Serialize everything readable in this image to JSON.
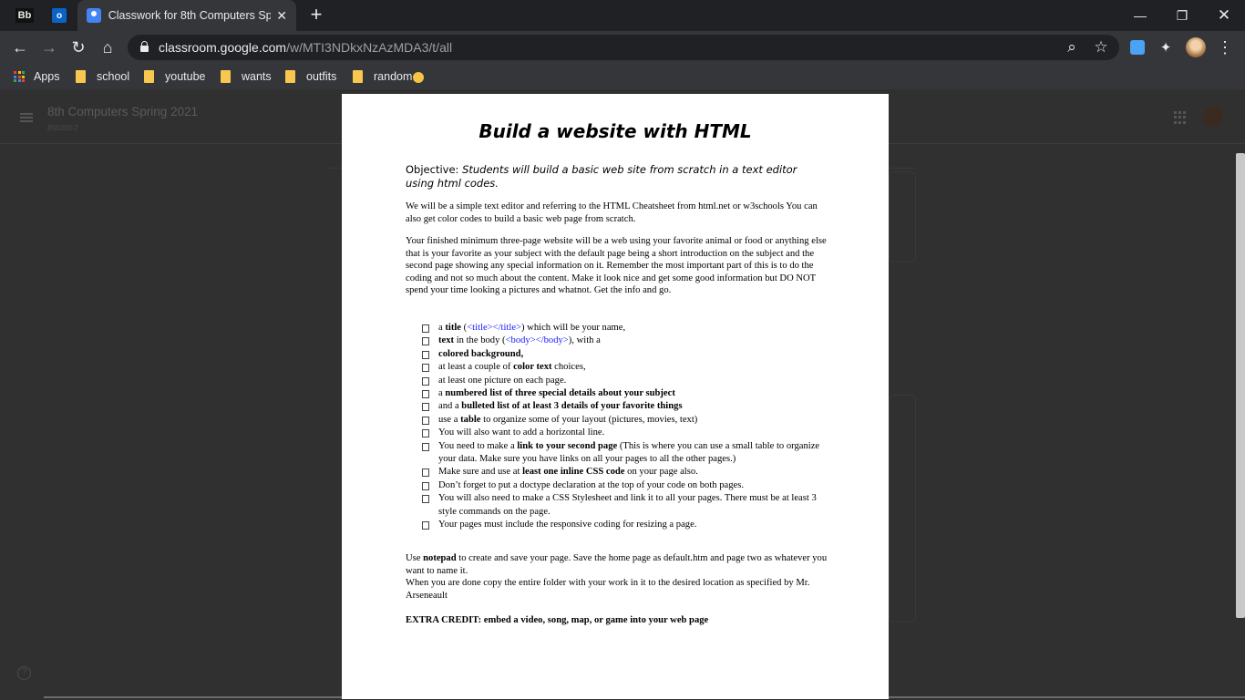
{
  "browser": {
    "pinned_tabs": [
      {
        "label": "Bb"
      },
      {
        "label": "o"
      }
    ],
    "active_tab": {
      "title": "Classwork for 8th Computers Spr",
      "close": "✕"
    },
    "new_tab": "+",
    "window_controls": {
      "minimize": "—",
      "restore": "❐",
      "close": "✕"
    },
    "nav": {
      "back": "←",
      "forward": "→",
      "reload": "↻",
      "home": "⌂"
    },
    "address": {
      "host": "classroom.google.com",
      "path": "/w/MTI3NDkxNzAzMDA3/t/all"
    },
    "omni_icons": {
      "zoom": "⌕",
      "star": "☆"
    },
    "extensions": {
      "puzzle": "✦",
      "menu": "⋮"
    },
    "bookmarks": [
      {
        "label": "Apps"
      },
      {
        "label": "school"
      },
      {
        "label": "youtube"
      },
      {
        "label": "wants"
      },
      {
        "label": "outfits"
      },
      {
        "label": "random"
      }
    ],
    "apps_colors": [
      "#ea4335",
      "#fbbc05",
      "#34a853",
      "#4285f4",
      "#ea4335",
      "#fbbc05",
      "#34a853",
      "#4285f4",
      "#ea4335"
    ]
  },
  "classroom": {
    "class_title": "8th Computers Spring 2021",
    "class_code": "850200-2",
    "help": "?"
  },
  "document": {
    "title": "Build a website with HTML",
    "objective_label": "Objective:",
    "objective_text": "Students will build a basic web site from scratch in a text editor using html codes.",
    "intro": "We will be a simple text editor and referring to the HTML Cheatsheet from html.net or w3schools You can also get color codes to build a basic web page from scratch.",
    "description": "Your finished minimum three-page website will be a web using your favorite animal or food or anything else that is your favorite as your subject with the default page being a short introduction on the subject and the second page showing any special information on it.  Remember the most important part of this is to do the coding and not so much about the content.  Make it look nice and get some good information but DO NOT spend your time looking a pictures and whatnot.  Get the info and go.",
    "checklist": {
      "i1_a": "a ",
      "i1_b": "title",
      "i1_c": " (",
      "i1_tag": "<title></title>",
      "i1_d": ") which will be your name,",
      "i2_b": "text",
      "i2_a": " in the body (",
      "i2_tag": "<body></body>",
      "i2_c": "), with a",
      "i3_b": "colored background",
      "i3_c": ",",
      "i4_a": "at least a couple of ",
      "i4_b": "color text",
      "i4_c": " choices,",
      "i5": "at least one picture on each page.",
      "i6_a": "a ",
      "i6_b": "numbered list of three special details about your subject",
      "i7_a": "and a ",
      "i7_b": "bulleted list of at least 3 details of your favorite things",
      "i8_a": "use a ",
      "i8_b": "table",
      "i8_c": " to organize some of your layout (pictures, movies, text)",
      "i9": "You will also want to add a horizontal line.",
      "i10_a": "You need to make a ",
      "i10_b": "link to your second page",
      "i10_c": " (This is where you can use a small table to organize your data.  Make sure you have links on all your pages to all the other pages.)",
      "i11_a": "Make sure and use at ",
      "i11_b": "least one inline CSS code",
      "i11_c": " on your page also.",
      "i12": "Don’t forget to put a doctype declaration at the top of your code on both pages.",
      "i13": "You will also need to make a CSS Stylesheet and link it to all your pages.  There must be at least 3 style commands on the page.",
      "i14": "Your pages must include the responsive coding for resizing a page."
    },
    "closing": {
      "a": "Use ",
      "b": "notepad",
      "c": " to create and save your page.  Save the home page as default.htm and page two as whatever you want to name it.",
      "d": "When you are done copy the entire folder with your work in it to the desired location as specified by Mr. Arseneault"
    },
    "extra_credit": "EXTRA CREDIT: embed a video, song, map, or game into your web page"
  }
}
